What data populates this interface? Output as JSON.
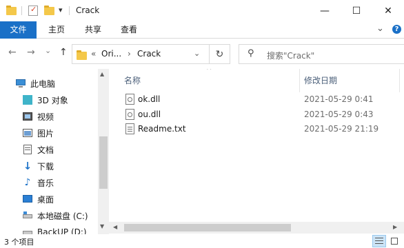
{
  "window": {
    "title": "Crack",
    "minimize_glyph": "—",
    "maximize_glyph": "☐",
    "close_glyph": "✕"
  },
  "quick_access": {
    "dropdown_glyph": "▾"
  },
  "ribbon": {
    "tabs": [
      "文件",
      "主页",
      "共享",
      "查看"
    ],
    "expand_glyph": "⌄",
    "help_glyph": "?"
  },
  "address": {
    "back_glyph": "←",
    "forward_glyph": "→",
    "recent_glyph": "⌄",
    "up_glyph": "↑",
    "overflow": "«",
    "crumbs": [
      "Ori...",
      "Crack"
    ],
    "sep_glyph": "›",
    "dropdown_glyph": "⌄",
    "refresh_glyph": "↻"
  },
  "search": {
    "placeholder": "搜索\"Crack\"",
    "icon_glyph": "⚲"
  },
  "nav_pane": {
    "items": [
      {
        "label": "此电脑",
        "icon": "computer-icon"
      },
      {
        "label": "3D 对象",
        "icon": "3d-objects-icon"
      },
      {
        "label": "视频",
        "icon": "video-icon"
      },
      {
        "label": "图片",
        "icon": "picture-icon"
      },
      {
        "label": "文档",
        "icon": "document-icon"
      },
      {
        "label": "下载",
        "icon": "download-icon"
      },
      {
        "label": "音乐",
        "icon": "music-icon"
      },
      {
        "label": "桌面",
        "icon": "desktop-icon"
      },
      {
        "label": "本地磁盘 (C:)",
        "icon": "drive-icon"
      },
      {
        "label": "BackUP (D:)",
        "icon": "drive-icon"
      }
    ],
    "scroll_up_glyph": "▲",
    "scroll_down_glyph": "▼"
  },
  "content": {
    "columns": {
      "name": "名称",
      "modified": "修改日期"
    },
    "sort_glyph": "^",
    "files": [
      {
        "name": "ok.dll",
        "modified": "2021-05-29 0:41",
        "icon": "dll-file-icon"
      },
      {
        "name": "ou.dll",
        "modified": "2021-05-29 0:43",
        "icon": "dll-file-icon"
      },
      {
        "name": "Readme.txt",
        "modified": "2021-05-29 21:19",
        "icon": "text-file-icon"
      }
    ],
    "scroll_left_glyph": "◀",
    "scroll_right_glyph": "▶"
  },
  "status_bar": {
    "item_count": "3 个项目"
  },
  "colors": {
    "accent": "#1a70c7",
    "folder": "#f4c84a",
    "header_text": "#4c607a"
  }
}
